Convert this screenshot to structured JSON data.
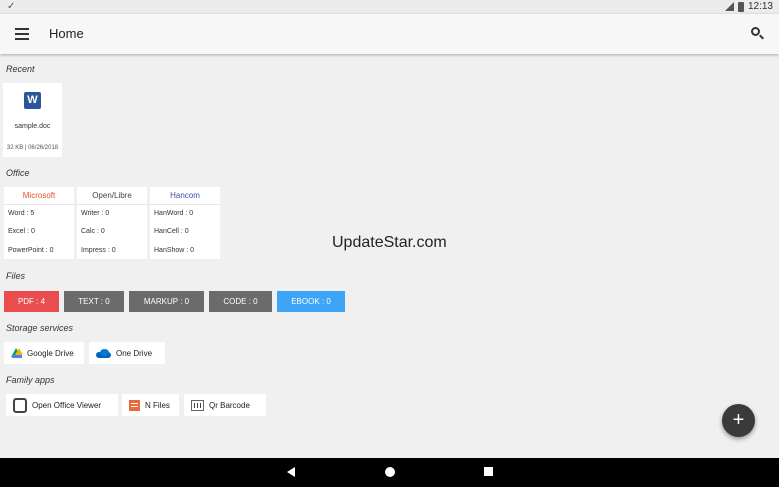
{
  "status": {
    "time": "12:13"
  },
  "header": {
    "title": "Home"
  },
  "sections": {
    "recent": "Recent",
    "office": "Office",
    "files": "Files",
    "storage": "Storage services",
    "family": "Family apps"
  },
  "recent": [
    {
      "name": "sample.doc",
      "meta": "32 KB | 06/26/2018",
      "icon": "word-icon"
    }
  ],
  "office": [
    {
      "title": "Microsoft",
      "color": "#e5512a",
      "rows": [
        "Word : 5",
        "Excel : 0",
        "PowerPoint : 0"
      ]
    },
    {
      "title": "Open/Libre",
      "color": "#444444",
      "rows": [
        "Writer : 0",
        "Calc : 0",
        "Impress : 0"
      ]
    },
    {
      "title": "Hancom",
      "color": "#3a4fb5",
      "rows": [
        "HanWord : 0",
        "HanCell : 0",
        "HanShow : 0"
      ]
    }
  ],
  "files": [
    {
      "label": "PDF : 4",
      "color": "#e94e4e"
    },
    {
      "label": "TEXT : 0",
      "color": "#6b6b6b"
    },
    {
      "label": "MARKUP : 0",
      "color": "#6b6b6b"
    },
    {
      "label": "CODE : 0",
      "color": "#6b6b6b"
    },
    {
      "label": "EBOOK : 0",
      "color": "#3ea4f5"
    }
  ],
  "storage": [
    {
      "label": "Google Drive",
      "icon": "google-drive-icon"
    },
    {
      "label": "One Drive",
      "icon": "onedrive-icon"
    }
  ],
  "family": [
    {
      "label": "Open Office Viewer",
      "icon": "open-office-viewer-icon"
    },
    {
      "label": "N Files",
      "icon": "n-files-icon"
    },
    {
      "label": "Qr Barcode",
      "icon": "qr-barcode-icon"
    }
  ],
  "watermark": "UpdateStar.com",
  "fab_label": "+"
}
